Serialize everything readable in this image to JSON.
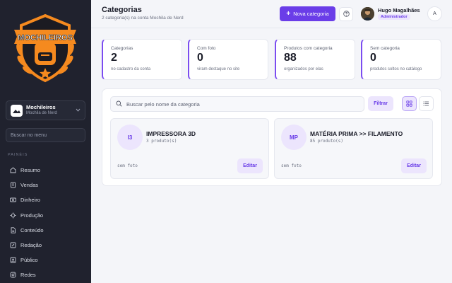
{
  "sidebar": {
    "logo_text": "MOCHILEIROS",
    "workspace": {
      "name": "Mochileiros",
      "subtitle": "Mochila de Nerd"
    },
    "search_placeholder": "Buscar no menu",
    "section_label": "PAINÉIS",
    "items": [
      {
        "label": "Resumo",
        "icon": "home-icon"
      },
      {
        "label": "Vendas",
        "icon": "receipt-icon"
      },
      {
        "label": "Dinheiro",
        "icon": "money-icon"
      },
      {
        "label": "Produção",
        "icon": "production-icon"
      },
      {
        "label": "Conteúdo",
        "icon": "document-icon"
      },
      {
        "label": "Redação",
        "icon": "pencil-icon"
      },
      {
        "label": "Público",
        "icon": "people-icon"
      },
      {
        "label": "Redes",
        "icon": "instagram-icon"
      }
    ]
  },
  "header": {
    "title": "Categorias",
    "subtitle": "2 categoria(s) na conta Mochila de Nerd",
    "new_button": "Nova categoria",
    "user": {
      "name": "Hugo Magalhães",
      "role": "Administrador"
    },
    "account_initial": "A"
  },
  "stats": [
    {
      "label": "Categorias",
      "value": "2",
      "hint": "no cadastro da conta"
    },
    {
      "label": "Com foto",
      "value": "0",
      "hint": "viram destaque no site"
    },
    {
      "label": "Produtos com categoria",
      "value": "88",
      "hint": "organizados por elas"
    },
    {
      "label": "Sem categoria",
      "value": "0",
      "hint": "produtos soltos no catálogo"
    }
  ],
  "panel": {
    "search_placeholder": "Buscar pelo nome da categoria",
    "filter_button": "Filtrar",
    "categories": [
      {
        "initials": "I3",
        "name": "IMPRESSORA 3D",
        "count": "3 produto(s)",
        "photo": "sem foto",
        "edit": "Editar"
      },
      {
        "initials": "MP",
        "name": "MATÉRIA PRIMA >> FILAMENTO",
        "count": "85 produto(s)",
        "photo": "sem foto",
        "edit": "Editar"
      }
    ]
  },
  "colors": {
    "sidebar_bg": "#20222e",
    "accent": "#6a3de8",
    "accent_light": "#ece5fd",
    "logo_orange": "#f58a1f"
  }
}
